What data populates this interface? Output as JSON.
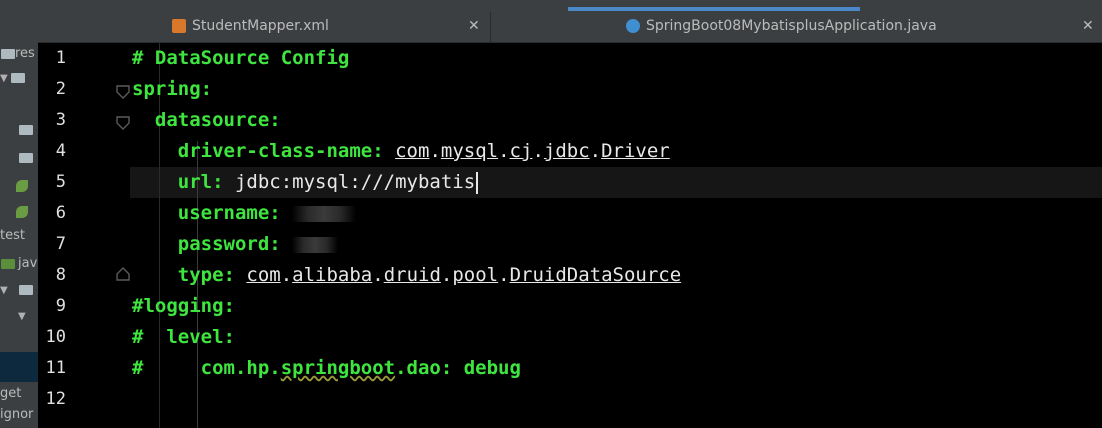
{
  "sidebar": {
    "items": [
      {
        "label": "res",
        "kind": "folder"
      },
      {
        "label": "",
        "kind": "folder"
      },
      {
        "label": "",
        "kind": "folder"
      },
      {
        "label": "",
        "kind": "folder"
      },
      {
        "label": "",
        "kind": "spring"
      },
      {
        "label": "",
        "kind": "spring"
      },
      {
        "label": "test",
        "kind": "text"
      },
      {
        "label": "jav",
        "kind": "folder-green"
      },
      {
        "label": "",
        "kind": "folder"
      },
      {
        "label": "get",
        "kind": "text"
      },
      {
        "label": "ignor",
        "kind": "text"
      }
    ]
  },
  "tabs": [
    {
      "label": "StudentMapper.xml",
      "icon": "xml-file-icon",
      "active": false
    },
    {
      "label": "SpringBoot08MybatisplusApplication.java",
      "icon": "spring-boot-class-icon",
      "active": false
    }
  ],
  "close_glyph": "✕",
  "editor": {
    "current_line": 5,
    "lines": [
      {
        "n": "1",
        "text": "# DataSource Config"
      },
      {
        "n": "2",
        "text": "spring:"
      },
      {
        "n": "3",
        "text": "  datasource:"
      },
      {
        "n": "4",
        "key": "    driver-class-name: ",
        "parts": [
          "com",
          ".",
          "mysql",
          ".",
          "cj",
          ".",
          "jdbc",
          ".",
          "Driver"
        ]
      },
      {
        "n": "5",
        "key": "    url: ",
        "value": "jdbc:mysql:///mybatis"
      },
      {
        "n": "6",
        "key": "    username: "
      },
      {
        "n": "7",
        "key": "    password: "
      },
      {
        "n": "8",
        "key": "    type: ",
        "parts": [
          "com",
          ".",
          "alibaba",
          ".",
          "druid",
          ".",
          "pool",
          ".",
          "DruidDataSource"
        ]
      },
      {
        "n": "9",
        "text": "#logging:"
      },
      {
        "n": "10",
        "text": "#  level:"
      },
      {
        "n": "11",
        "pre": "#     com.hp.",
        "wavy": "springboot",
        "post": ".dao: debug"
      },
      {
        "n": "12",
        "text": ""
      }
    ]
  }
}
